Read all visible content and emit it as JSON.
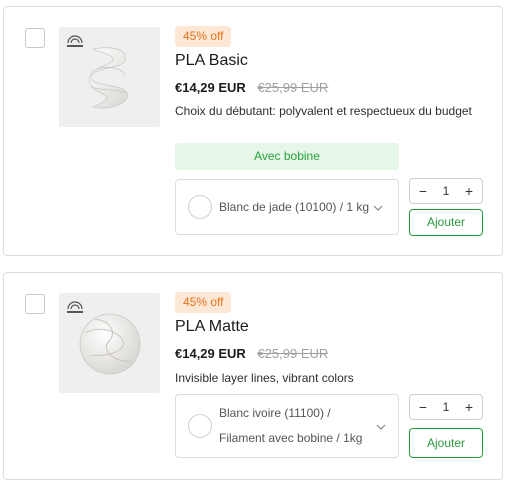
{
  "products": [
    {
      "discount_badge": "45% off",
      "title": "PLA Basic",
      "price": "€14,29 EUR",
      "compare_price": "€25,99 EUR",
      "description": "Choix du débutant: polyvalent et respectueux du budget",
      "note": "Avec bobine",
      "variant_label": "Blanc de jade (10100) / 1 kg",
      "quantity": "1",
      "add_label": "Ajouter",
      "image_icon": "spool-icon"
    },
    {
      "discount_badge": "45% off",
      "title": "PLA Matte",
      "price": "€14,29 EUR",
      "compare_price": "€25,99 EUR",
      "description": "Invisible layer lines, vibrant colors",
      "variant_label": "Blanc ivoire (11100) / Filament avec bobine / 1kg",
      "quantity": "1",
      "add_label": "Ajouter",
      "image_icon": "spool-icon"
    }
  ],
  "colors": {
    "badge_bg": "#fde7d5",
    "badge_text": "#e8731e",
    "accent_green": "#2a9a3e",
    "note_bg": "#e6f6e7"
  }
}
